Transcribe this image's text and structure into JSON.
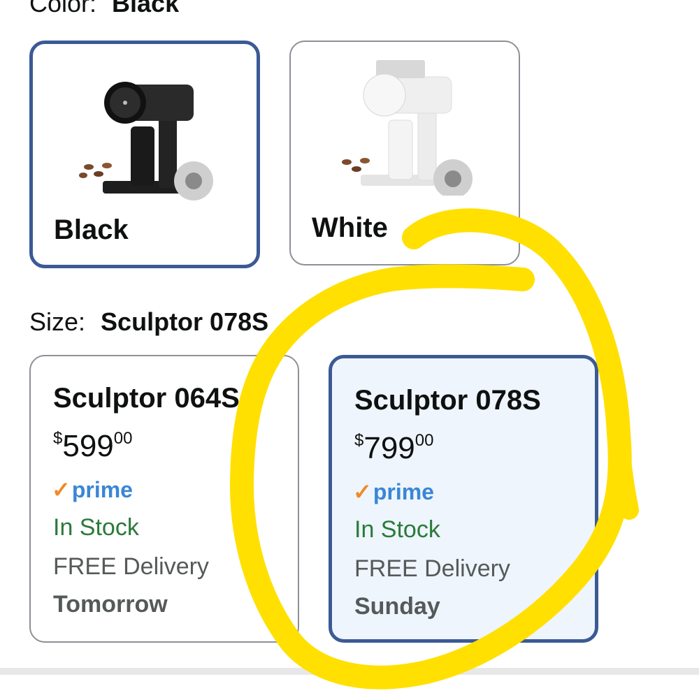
{
  "color_selector": {
    "label": "Color:",
    "selected_value": "Black",
    "options": [
      {
        "name": "Black",
        "selected": true
      },
      {
        "name": "White",
        "selected": false
      }
    ]
  },
  "size_selector": {
    "label": "Size:",
    "selected_value": "Sculptor 078S",
    "options": [
      {
        "name": "Sculptor 064S",
        "price_symbol": "$",
        "price_whole": "599",
        "price_fraction": "00",
        "prime_label": "prime",
        "stock": "In Stock",
        "delivery": "FREE Delivery",
        "delivery_day": "Tomorrow",
        "selected": false
      },
      {
        "name": "Sculptor 078S",
        "price_symbol": "$",
        "price_whole": "799",
        "price_fraction": "00",
        "prime_label": "prime",
        "stock": "In Stock",
        "delivery": "FREE Delivery",
        "delivery_day": "Sunday",
        "selected": true
      }
    ]
  },
  "colors": {
    "selected_border": "#3b5a95",
    "selected_bg": "#eef5fc",
    "stock_green": "#2b7a3a",
    "prime_blue": "#3a86d6",
    "prime_check": "#f08a24",
    "annotation_yellow": "#ffe000"
  }
}
